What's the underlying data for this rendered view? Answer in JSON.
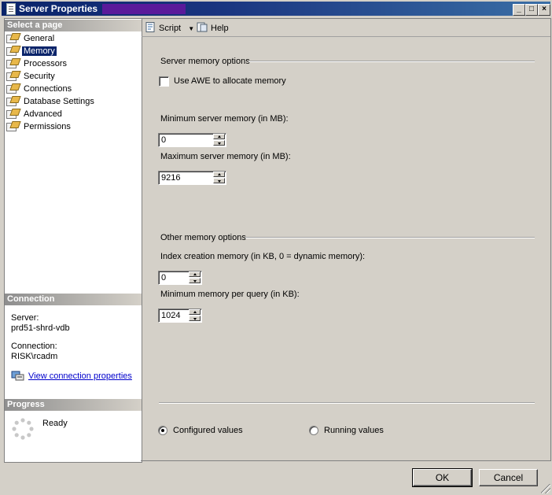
{
  "window": {
    "title": "Server Properties"
  },
  "left": {
    "select_header": "Select a page",
    "pages": [
      "General",
      "Memory",
      "Processors",
      "Security",
      "Connections",
      "Database Settings",
      "Advanced",
      "Permissions"
    ],
    "selected_index": 1,
    "connection_header": "Connection",
    "server_label": "Server:",
    "server_value": "prd51-shrd-vdb",
    "connection_label": "Connection:",
    "connection_value": "RISK\\rcadm",
    "view_link": "View connection properties",
    "progress_header": "Progress",
    "progress_status": "Ready"
  },
  "toolbar": {
    "script_label": "Script",
    "help_label": "Help"
  },
  "server_memory": {
    "section": "Server memory options",
    "awe_label": "Use AWE to allocate memory",
    "awe_checked": false,
    "min_label": "Minimum server memory (in MB):",
    "min_value": "0",
    "max_label": "Maximum server memory (in MB):",
    "max_value": "9216"
  },
  "other_memory": {
    "section": "Other memory options",
    "index_label": "Index creation memory (in KB, 0 = dynamic memory):",
    "index_value": "0",
    "query_label": "Minimum memory per query (in KB):",
    "query_value": "1024"
  },
  "values_mode": {
    "configured_label": "Configured values",
    "running_label": "Running values",
    "selected": "configured"
  },
  "buttons": {
    "ok": "OK",
    "cancel": "Cancel"
  }
}
